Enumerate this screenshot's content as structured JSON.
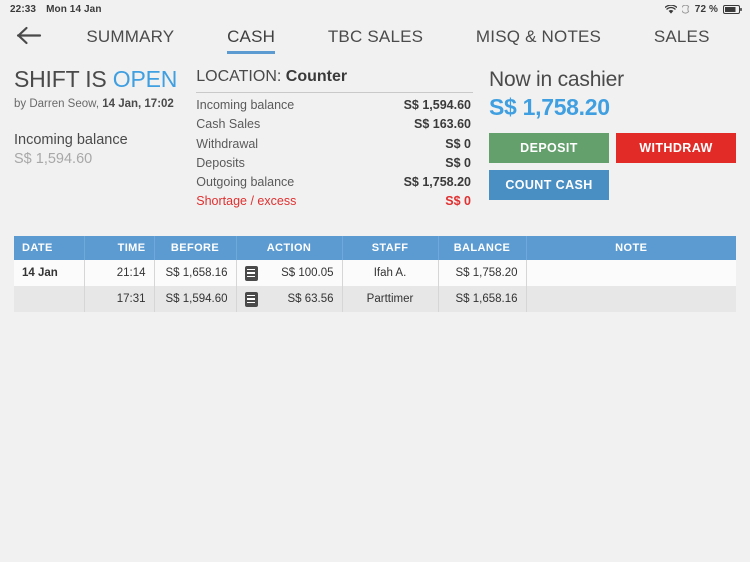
{
  "status_bar": {
    "time": "22:33",
    "date": "Mon 14 Jan",
    "battery_percent": "72 %",
    "icons": [
      "wifi-icon",
      "do-not-disturb-moon-icon",
      "battery-icon"
    ]
  },
  "nav": {
    "back_icon": "back-arrow-icon",
    "tabs": [
      {
        "label": "SUMMARY",
        "active": false
      },
      {
        "label": "CASH",
        "active": true
      },
      {
        "label": "TBC SALES",
        "active": false
      },
      {
        "label": "MISQ & NOTES",
        "active": false
      },
      {
        "label": "SALES",
        "active": false
      }
    ]
  },
  "shift": {
    "title_prefix": "SHIFT IS ",
    "state": "OPEN",
    "by_prefix": "by Darren Seow, ",
    "by_datetime": "14 Jan, 17:02",
    "incoming_label": "Incoming balance",
    "incoming_value": "S$ 1,594.60"
  },
  "location": {
    "label": "LOCATION: ",
    "name": "Counter",
    "rows": [
      {
        "key": "Incoming balance",
        "value": "S$ 1,594.60",
        "alert": false
      },
      {
        "key": "Cash Sales",
        "value": "S$ 163.60",
        "alert": false
      },
      {
        "key": "Withdrawal",
        "value": "S$ 0",
        "alert": false
      },
      {
        "key": "Deposits",
        "value": "S$ 0",
        "alert": false
      },
      {
        "key": "Outgoing balance",
        "value": "S$ 1,758.20",
        "alert": false
      },
      {
        "key": "Shortage / excess",
        "value": "S$ 0",
        "alert": true
      }
    ]
  },
  "cashier": {
    "label": "Now in cashier",
    "amount": "S$ 1,758.20",
    "buttons": {
      "deposit": "DEPOSIT",
      "withdraw": "WITHDRAW",
      "count_cash": "COUNT CASH"
    }
  },
  "table": {
    "headers": {
      "date": "DATE",
      "time": "TIME",
      "before": "BEFORE",
      "action": "ACTION",
      "staff": "STAFF",
      "balance": "BALANCE",
      "note": "NOTE"
    },
    "rows": [
      {
        "date": "14 Jan",
        "time": "21:14",
        "before": "S$ 1,658.16",
        "action_icon": "receipt-icon",
        "action": "S$ 100.05",
        "staff": "Ifah A.",
        "balance": "S$ 1,758.20",
        "note": ""
      },
      {
        "date": "",
        "time": "17:31",
        "before": "S$ 1,594.60",
        "action_icon": "receipt-icon",
        "action": "S$ 63.56",
        "staff": "Parttimer",
        "balance": "S$ 1,658.16",
        "note": ""
      }
    ]
  },
  "colors": {
    "accent_blue": "#5b9bd1",
    "link_blue": "#3f9fe0",
    "green": "#63a06b",
    "red": "#e22b26",
    "alert_red": "#e03030",
    "page_bg": "#f1f1f1"
  }
}
